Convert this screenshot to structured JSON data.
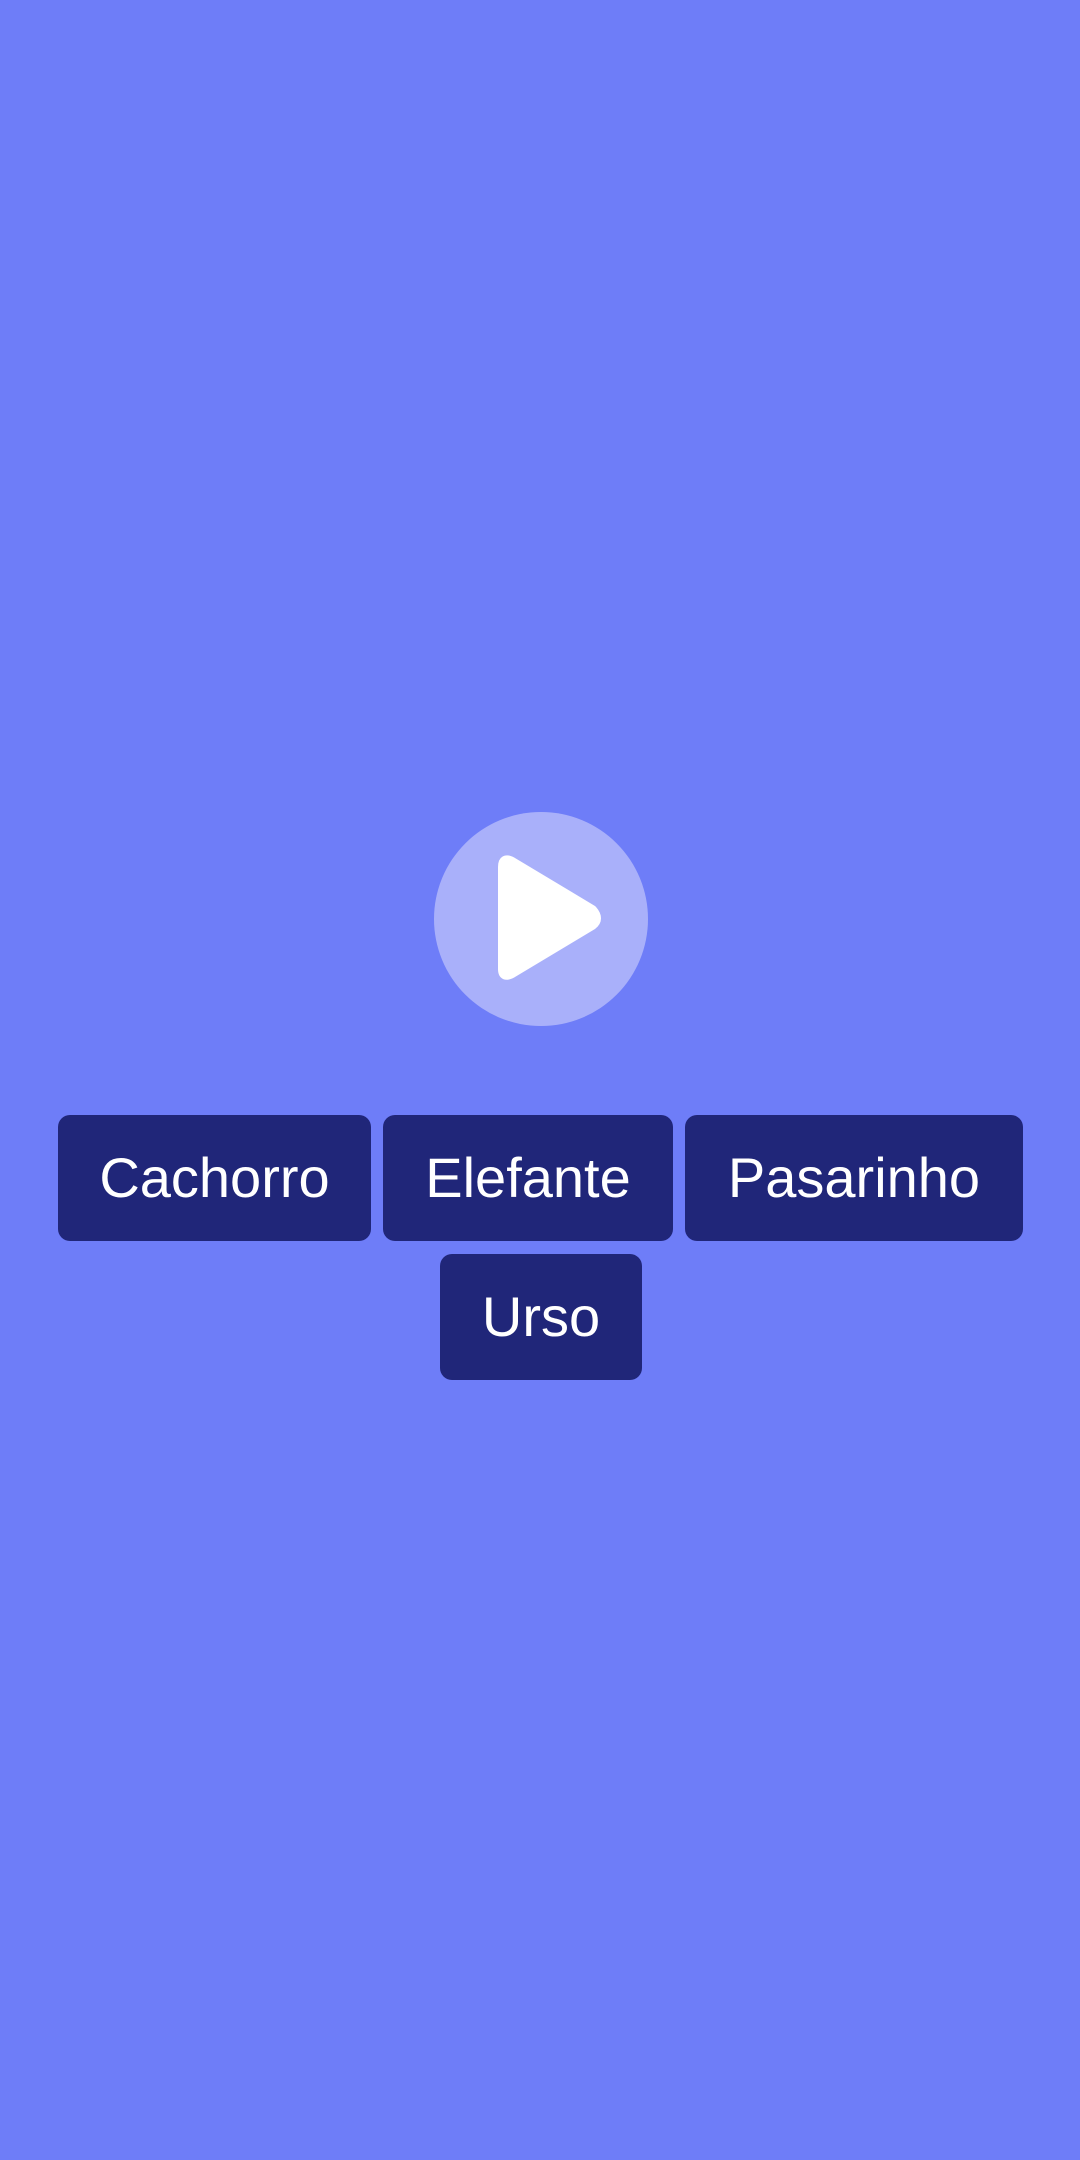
{
  "colors": {
    "background": "#6e7df8",
    "play_button_bg": "#a9b0fa",
    "play_icon": "#ffffff",
    "option_bg": "#202679",
    "option_text": "#ffffff"
  },
  "play_button": {
    "icon": "play-icon"
  },
  "options": [
    {
      "label": "Cachorro"
    },
    {
      "label": "Elefante"
    },
    {
      "label": "Pasarinho"
    },
    {
      "label": "Urso"
    }
  ]
}
